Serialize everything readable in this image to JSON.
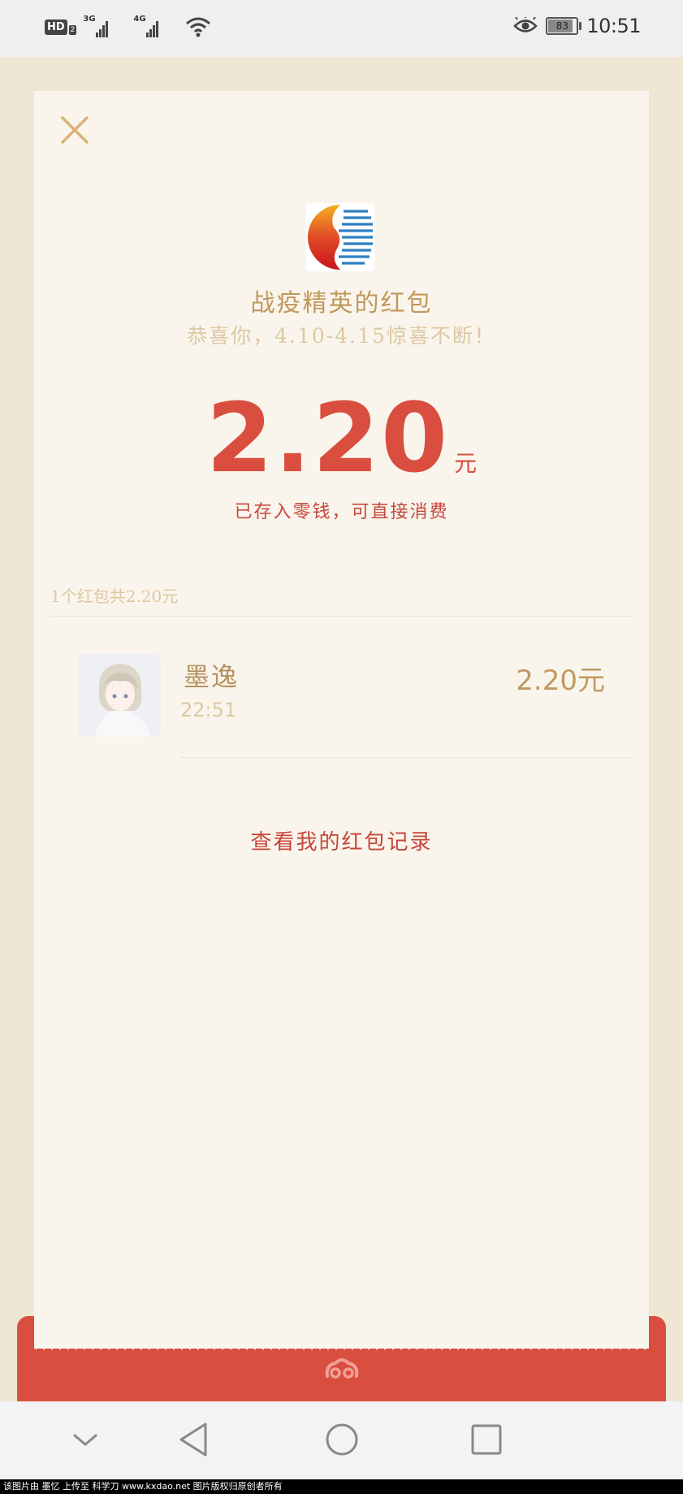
{
  "status_bar": {
    "hd_label": "HD",
    "hd_sub": "2",
    "net1_label": "3G",
    "net2_label": "4G",
    "battery": "83",
    "time": "10:51"
  },
  "packet": {
    "sender_title": "战疫精英的红包",
    "wish": "恭喜你，4.10-4.15惊喜不断！",
    "amount": "2.20",
    "amount_unit": "元",
    "note": "已存入零钱，可直接消费",
    "summary": "1个红包共2.20元"
  },
  "receiver": {
    "name": "墨逸",
    "time": "22:51",
    "amount": "2.20元"
  },
  "records_link": "查看我的红包记录",
  "footer": "该图片由 墨忆 上传至 科学刀 www.kxdao.net 图片版权归原创者所有",
  "colors": {
    "accent_red": "#d94e3f",
    "gold": "#c0985a",
    "card_bg": "#faf5ec",
    "page_bg": "#efe6d4"
  }
}
